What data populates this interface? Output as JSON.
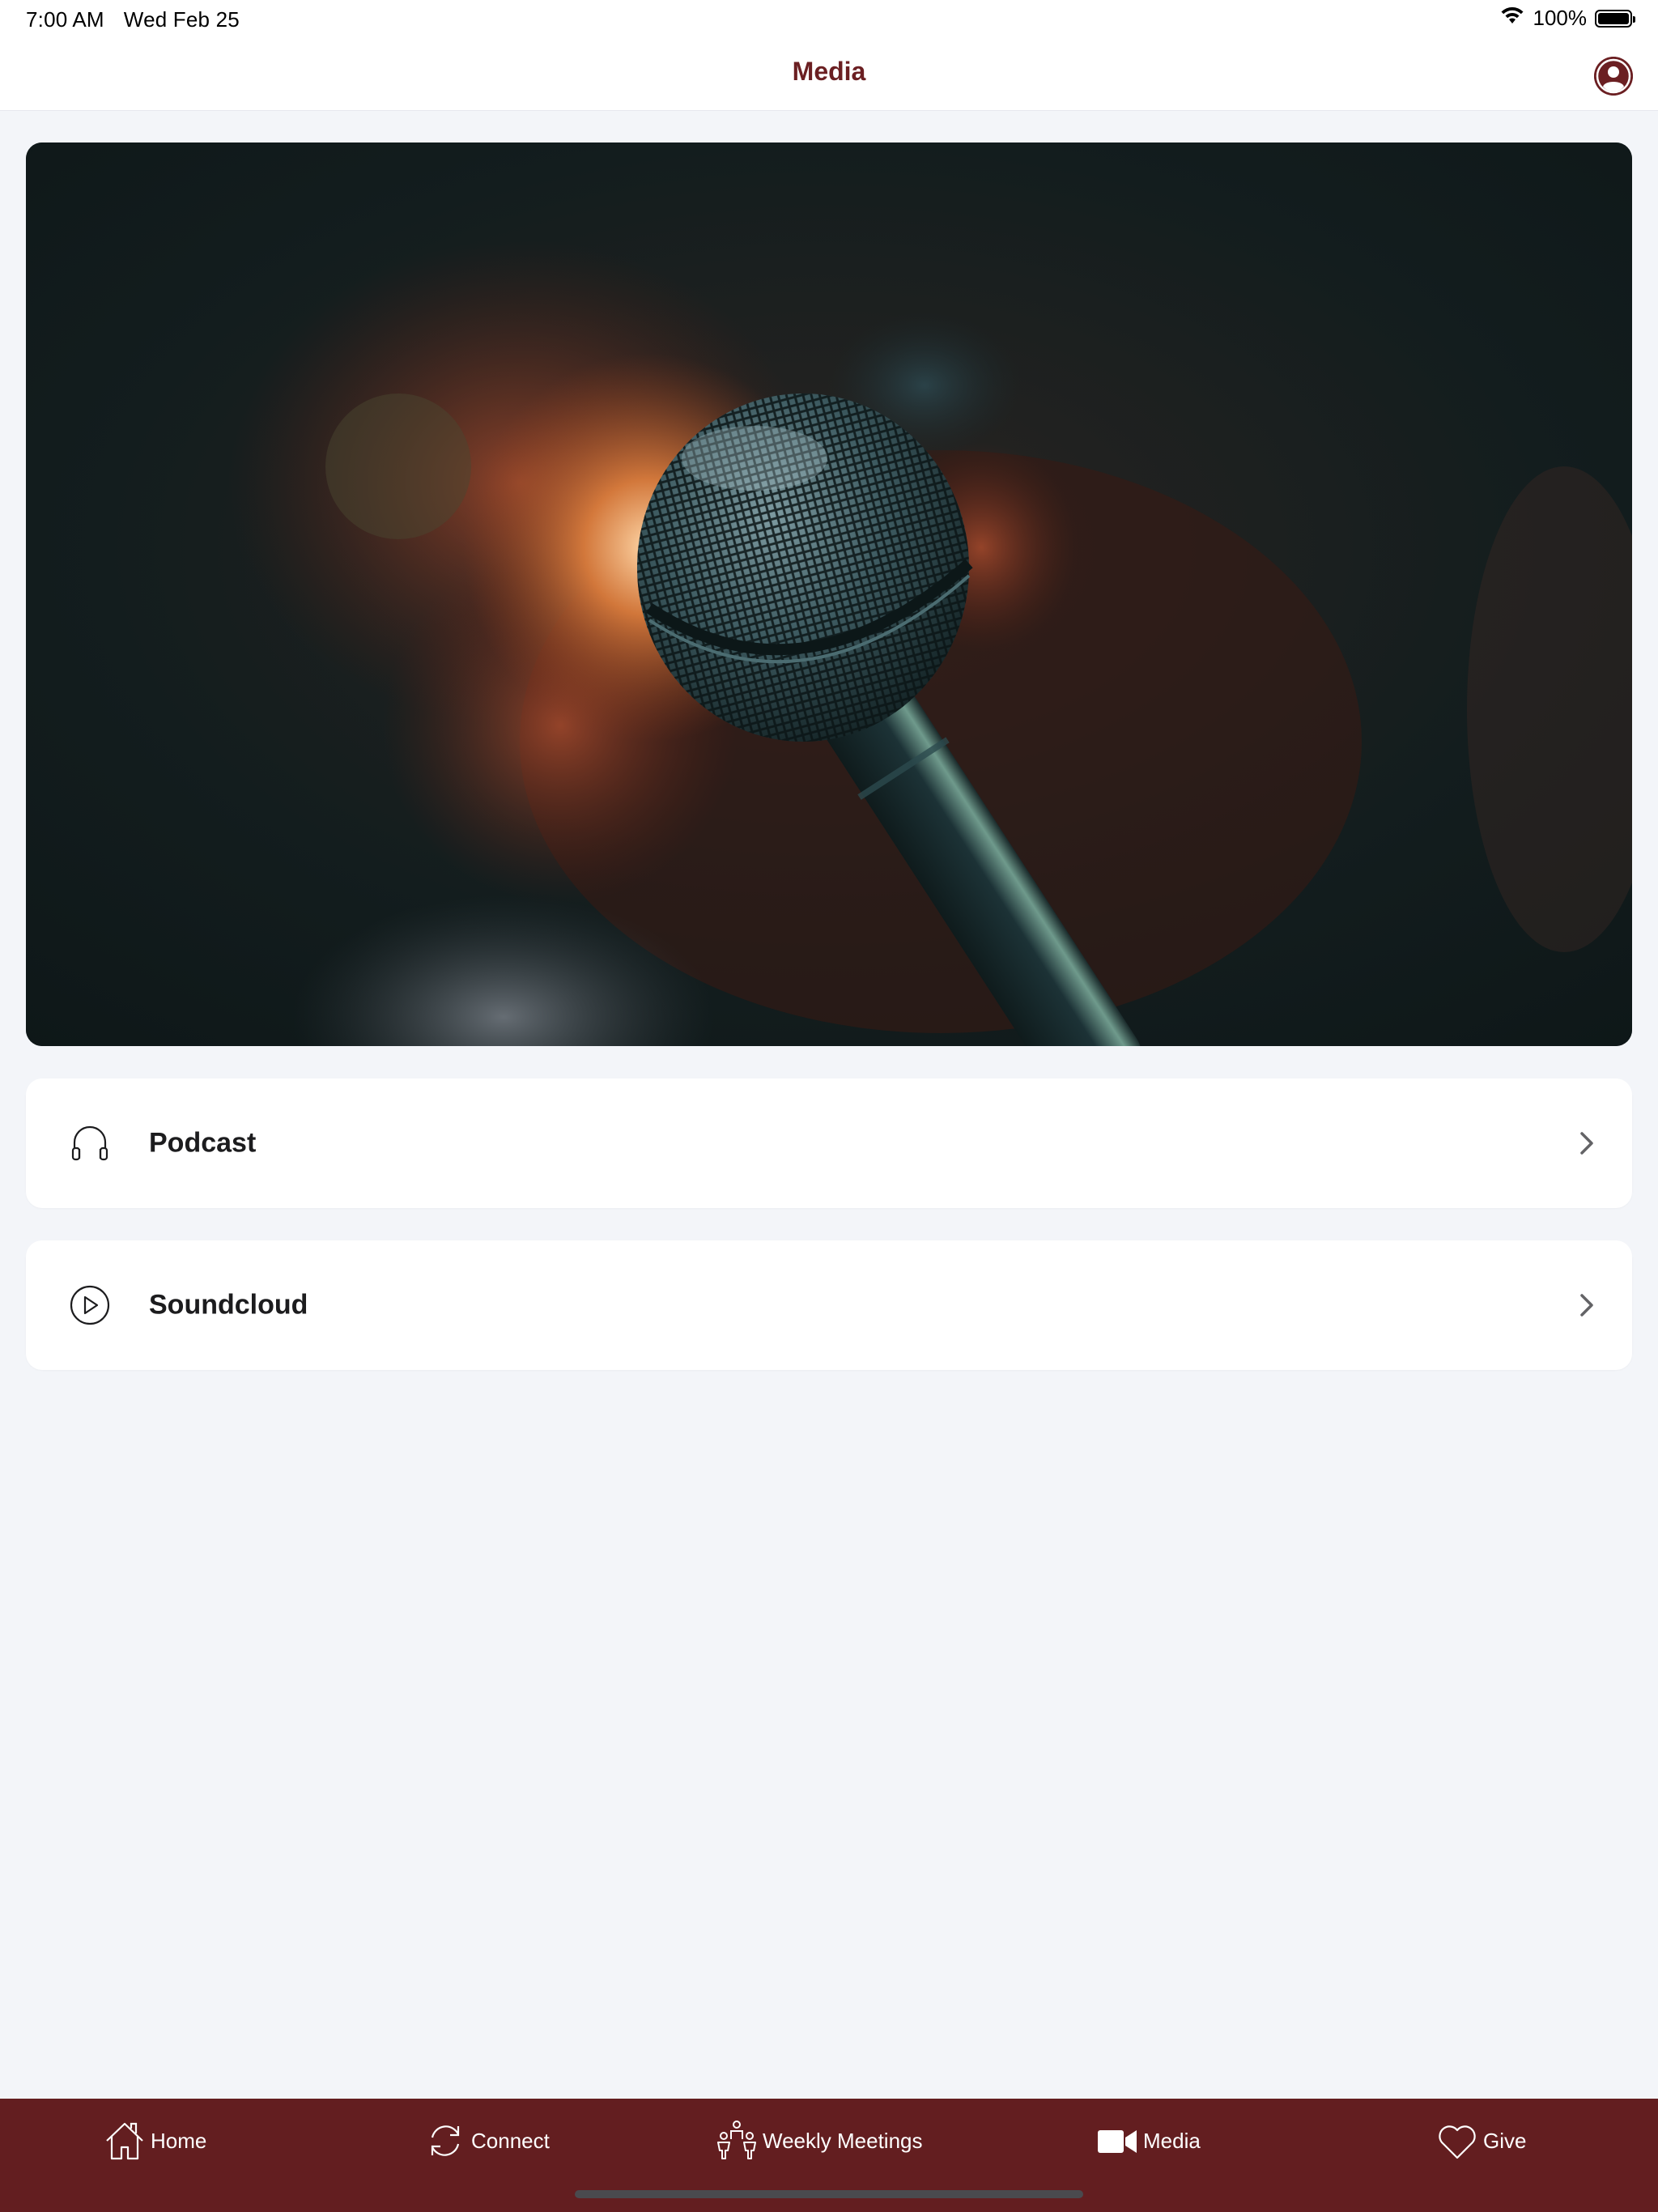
{
  "status_bar": {
    "time": "7:00 AM",
    "date": "Wed Feb 25",
    "battery": "100%",
    "icons": [
      "wifi-icon",
      "battery-icon"
    ]
  },
  "header": {
    "title": "Media",
    "profile_icon": "person-circle-icon"
  },
  "hero": {
    "image_subject": "microphone photo"
  },
  "menu": {
    "items": [
      {
        "label": "Podcast",
        "icon": "headphones-icon"
      },
      {
        "label": "Soundcloud",
        "icon": "play-circle-icon"
      }
    ]
  },
  "tabs": [
    {
      "label": "Home",
      "icon": "home-icon"
    },
    {
      "label": "Connect",
      "icon": "refresh-icon"
    },
    {
      "label": "Weekly Meetings",
      "icon": "people-icon"
    },
    {
      "label": "Media",
      "icon": "video-camera-icon"
    },
    {
      "label": "Give",
      "icon": "heart-icon"
    }
  ],
  "colors": {
    "brand": "#631e20",
    "title": "#6b1f22",
    "background": "#f3f5f9",
    "card": "#ffffff"
  }
}
